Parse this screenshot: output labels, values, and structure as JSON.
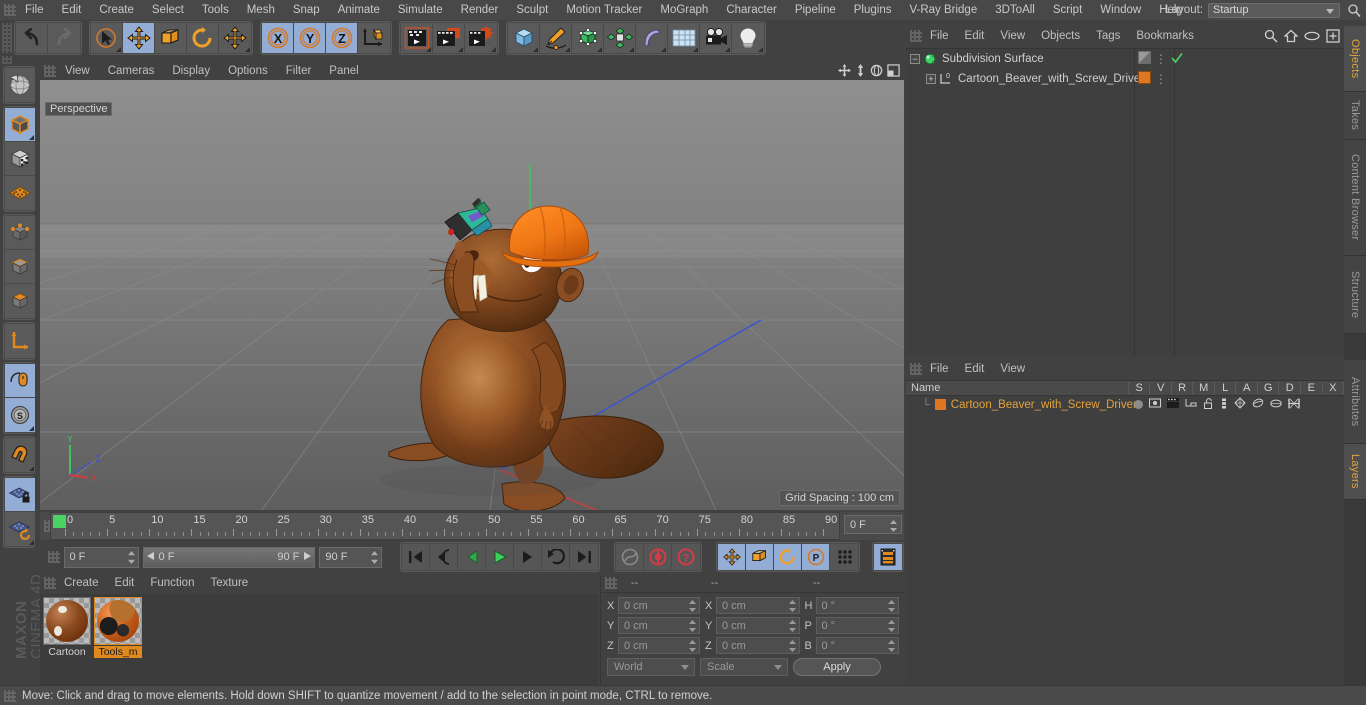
{
  "menubar": {
    "items": [
      "File",
      "Edit",
      "Create",
      "Select",
      "Tools",
      "Mesh",
      "Snap",
      "Animate",
      "Simulate",
      "Render",
      "Sculpt",
      "Motion Tracker",
      "MoGraph",
      "Character",
      "Pipeline",
      "Plugins",
      "V-Ray Bridge",
      "3DToAll",
      "Script",
      "Window",
      "Help"
    ],
    "layout_label": "Layout:",
    "layout_value": "Startup"
  },
  "toolbar": {
    "groups": [
      {
        "name": "history",
        "buttons": [
          {
            "icon": "undo-icon",
            "label": "Undo",
            "active": false
          },
          {
            "icon": "redo-icon",
            "label": "Redo",
            "active": false
          }
        ]
      },
      {
        "name": "tools",
        "buttons": [
          {
            "icon": "select-arrow-icon",
            "label": "Live Selection",
            "active": false
          },
          {
            "icon": "move-icon",
            "label": "Move",
            "active": true
          },
          {
            "icon": "scale-icon",
            "label": "Scale",
            "active": false
          },
          {
            "icon": "rotate-icon",
            "label": "Rotate",
            "active": false
          },
          {
            "icon": "move-alt-icon",
            "label": "Move Tool",
            "active": false
          }
        ]
      },
      {
        "name": "axes",
        "buttons": [
          {
            "icon": "axis-x-icon",
            "label": "X",
            "active": true
          },
          {
            "icon": "axis-y-icon",
            "label": "Y",
            "active": true
          },
          {
            "icon": "axis-z-icon",
            "label": "Z",
            "active": true
          },
          {
            "icon": "world-coord-icon",
            "label": "World Coordinates",
            "active": false
          }
        ]
      },
      {
        "name": "render",
        "buttons": [
          {
            "icon": "render-view-icon",
            "label": "Render View",
            "active": false
          },
          {
            "icon": "render-region-icon",
            "label": "Render to Picture Viewer",
            "active": false
          },
          {
            "icon": "render-settings-icon",
            "label": "Edit Render Settings",
            "active": false
          }
        ]
      },
      {
        "name": "create",
        "buttons": [
          {
            "icon": "cube-icon",
            "label": "Cube",
            "active": false
          },
          {
            "icon": "spline-pen-icon",
            "label": "Pen",
            "active": false
          },
          {
            "icon": "nurbs-icon",
            "label": "Subdivision Surface",
            "active": false
          },
          {
            "icon": "mograph-icon",
            "label": "MoGraph",
            "active": false
          },
          {
            "icon": "deformer-icon",
            "label": "Bend Deformer",
            "active": false
          },
          {
            "icon": "environment-icon",
            "label": "Floor",
            "active": false
          },
          {
            "icon": "camera-icon",
            "label": "Camera",
            "active": false
          },
          {
            "icon": "light-icon",
            "label": "Light",
            "active": false
          }
        ]
      }
    ]
  },
  "leftbar": {
    "groups": [
      {
        "buttons": [
          {
            "icon": "texture-axis-icon",
            "label": "Texture Axis",
            "active": false
          }
        ]
      },
      {
        "buttons": [
          {
            "icon": "model-mode-icon",
            "label": "Model Mode",
            "active": true
          },
          {
            "icon": "texture-mode-icon",
            "label": "Texture Mode",
            "active": false
          },
          {
            "icon": "workplane-icon",
            "label": "Workplane",
            "active": false
          }
        ]
      },
      {
        "buttons": [
          {
            "icon": "point-mode-icon",
            "label": "Points",
            "active": false
          },
          {
            "icon": "edge-mode-icon",
            "label": "Edges",
            "active": false
          },
          {
            "icon": "polygon-mode-icon",
            "label": "Polygons",
            "active": false
          }
        ]
      },
      {
        "buttons": [
          {
            "icon": "object-axis-icon",
            "label": "Enable Axis",
            "active": false
          }
        ]
      },
      {
        "buttons": [
          {
            "icon": "viewport-solo-icon",
            "label": "Viewport Solo",
            "active": true
          },
          {
            "icon": "soft-selection-icon",
            "label": "Soft Selection",
            "active": true
          }
        ]
      },
      {
        "buttons": [
          {
            "icon": "magnet-icon",
            "label": "Magnet",
            "active": false
          }
        ]
      },
      {
        "buttons": [
          {
            "icon": "workplane-lock-icon",
            "label": "Lock Workplane",
            "active": true
          },
          {
            "icon": "workplane-reset-icon",
            "label": "Planar Workplane",
            "active": false
          }
        ]
      }
    ],
    "brand_top": "MAXON",
    "brand_bottom": "CINEMA 4D"
  },
  "viewport": {
    "menu": [
      "View",
      "Cameras",
      "Display",
      "Options",
      "Filter",
      "Panel"
    ],
    "label": "Perspective",
    "grid_spacing": "Grid Spacing : 100 cm",
    "axis": {
      "x": "X",
      "y": "Y",
      "z": "Z"
    },
    "nav_icons": [
      "pan-icon",
      "zoom-icon",
      "orbit-icon",
      "maximize-icon"
    ],
    "scene_object": "Cartoon_Beaver_with_Screw_Driver"
  },
  "timeline": {
    "start_frame": "0 F",
    "end_frame": "90 F",
    "current_frame": "0 F",
    "range_start": "0 F",
    "range_end": "90 F",
    "preview_end": "90 F",
    "ticks": [
      0,
      5,
      10,
      15,
      20,
      25,
      30,
      35,
      40,
      45,
      50,
      55,
      60,
      65,
      70,
      75,
      80,
      85,
      90
    ]
  },
  "transport": {
    "buttons": [
      {
        "icon": "go-to-start-icon",
        "label": "Go to Start",
        "active": false
      },
      {
        "icon": "step-back-key-icon",
        "label": "Go to Previous Key",
        "active": false
      },
      {
        "icon": "step-back-icon",
        "label": "Go to Previous Frame",
        "active": false
      },
      {
        "icon": "play-icon",
        "label": "Play",
        "active": false
      },
      {
        "icon": "step-forward-icon",
        "label": "Go to Next Frame",
        "active": false
      },
      {
        "icon": "step-forward-key-icon",
        "label": "Go to Next Key",
        "active": false
      },
      {
        "icon": "go-to-end-icon",
        "label": "Go to End",
        "active": false
      }
    ],
    "record_group": [
      {
        "icon": "autokey-icon",
        "label": "Autokeying",
        "active": false
      },
      {
        "icon": "record-icon",
        "label": "Record Active Objects",
        "active": false
      },
      {
        "icon": "keyframe-selection-icon",
        "label": "Keyframe Selection",
        "active": false
      }
    ],
    "param_group": [
      {
        "icon": "position-key-icon",
        "label": "Record Position",
        "active": true
      },
      {
        "icon": "scale-key-icon",
        "label": "Record Scale",
        "active": true
      },
      {
        "icon": "rotation-key-icon",
        "label": "Record Rotation",
        "active": true
      },
      {
        "icon": "pla-key-icon",
        "label": "Record PLA",
        "active": true
      },
      {
        "icon": "point-level-anim-icon",
        "label": "Point Level Animation",
        "active": false
      }
    ],
    "timeline_toggle": {
      "icon": "timeline-icon",
      "label": "Show F-Curve",
      "active": true
    }
  },
  "material_manager": {
    "menu": [
      "Create",
      "Edit",
      "Function",
      "Texture"
    ],
    "materials": [
      {
        "name": "Cartoon",
        "selected": false,
        "color": "#8a4a1e"
      },
      {
        "name": "Tools_m",
        "selected": true,
        "color": "#c4601c"
      }
    ]
  },
  "coordinates": {
    "headers": [
      "--",
      "--",
      "--"
    ],
    "rows": [
      {
        "label_a": "X",
        "value_a": "0 cm",
        "label_b": "X",
        "value_b": "0 cm",
        "label_c": "H",
        "value_c": "0 °"
      },
      {
        "label_a": "Y",
        "value_a": "0 cm",
        "label_b": "Y",
        "value_b": "0 cm",
        "label_c": "P",
        "value_c": "0 °"
      },
      {
        "label_a": "Z",
        "value_a": "0 cm",
        "label_b": "Z",
        "value_b": "0 cm",
        "label_c": "B",
        "value_c": "0 °"
      }
    ],
    "system": "World",
    "mode": "Scale",
    "apply": "Apply"
  },
  "object_manager": {
    "menu": [
      "File",
      "Edit",
      "View",
      "Objects",
      "Tags",
      "Bookmarks"
    ],
    "icons": [
      "search-icon",
      "home-icon",
      "eye-icon",
      "new-window-icon"
    ],
    "rows": [
      {
        "name": "Subdivision Surface",
        "indent": 0,
        "icon": "subdivision-surface-icon",
        "has_check": true
      },
      {
        "name": "Cartoon_Beaver_with_Screw_Driver",
        "indent": 1,
        "icon": "null-object-icon",
        "has_check": false,
        "tag_color": "#dd7722"
      }
    ]
  },
  "layer_manager": {
    "menu": [
      "File",
      "Edit",
      "View"
    ],
    "columns": [
      "Name",
      "S",
      "V",
      "R",
      "M",
      "L",
      "A",
      "G",
      "D",
      "E",
      "X"
    ],
    "rows": [
      {
        "name": "Cartoon_Beaver_with_Screw_Driver",
        "color": "#dd7722"
      }
    ]
  },
  "side_tabs": {
    "top": [
      "Objects",
      "Takes",
      "Content Browser",
      "Structure"
    ],
    "bottom": [
      "Attributes",
      "Layers"
    ],
    "active_top": "Objects",
    "active_bottom": "Layers"
  },
  "statusbar": {
    "message": "Move: Click and drag to move elements. Hold down SHIFT to quantize movement / add to the selection in point mode, CTRL to remove."
  },
  "colors": {
    "accent_orange": "#e0891f",
    "active_blue": "#93add4",
    "panel_bg": "#414141",
    "list_bg": "#3f3f3f"
  }
}
